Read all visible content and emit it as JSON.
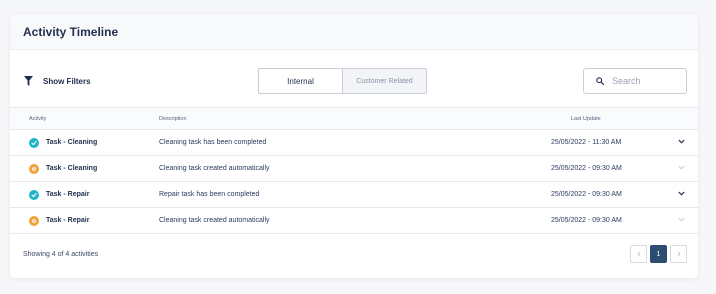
{
  "header": {
    "title": "Activity Timeline"
  },
  "toolbar": {
    "show_filters_label": "Show Filters",
    "tabs": [
      {
        "label": "Internal",
        "active": true
      },
      {
        "label": "Customer Related",
        "active": false
      }
    ],
    "search": {
      "placeholder": "Search",
      "value": ""
    }
  },
  "table": {
    "columns": [
      "Activity",
      "Description",
      "Last Update"
    ],
    "rows": [
      {
        "status": "completed",
        "status_color": "#1fb5c8",
        "activity": "Task - Cleaning",
        "description": "Cleaning task has been completed",
        "last_update": "25/05/2022 - 11:30 AM",
        "expand_enabled": true
      },
      {
        "status": "created",
        "status_color": "#f2a23a",
        "activity": "Task - Cleaning",
        "description": "Cleaning task created automatically",
        "last_update": "25/05/2022 - 09:30 AM",
        "expand_enabled": false
      },
      {
        "status": "completed",
        "status_color": "#1fb5c8",
        "activity": "Task - Repair",
        "description": "Repair task has been completed",
        "last_update": "25/05/2022 - 09:30 AM",
        "expand_enabled": true
      },
      {
        "status": "created",
        "status_color": "#f2a23a",
        "activity": "Task - Repair",
        "description": "Cleaning task created automatically",
        "last_update": "25/05/2022 - 09:30 AM",
        "expand_enabled": false
      }
    ]
  },
  "footer": {
    "summary": "Showing 4 of 4 activities"
  },
  "pagination": {
    "prev_icon": "chevron-left-icon",
    "pages": [
      "1"
    ],
    "current": "1",
    "next_icon": "chevron-right-icon"
  },
  "colors": {
    "accent": "#2d4c72",
    "completed": "#1fb5c8",
    "created": "#f2a23a"
  }
}
